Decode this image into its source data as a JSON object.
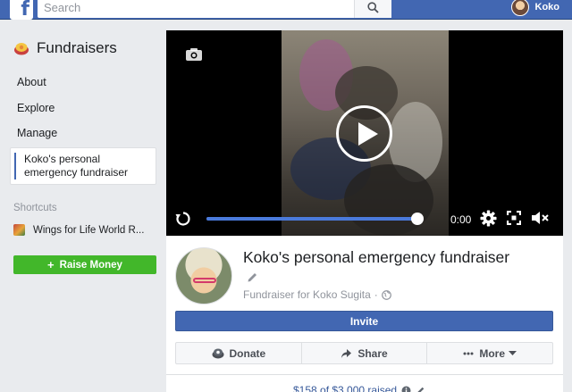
{
  "topbar": {
    "logo_letter": "f",
    "search_placeholder": "Search",
    "user_name": "Koko"
  },
  "sidebar": {
    "title": "Fundraisers",
    "links": [
      "About",
      "Explore",
      "Manage"
    ],
    "active_item": "Koko's personal emergency fundraiser",
    "shortcuts_label": "Shortcuts",
    "shortcut_item": "Wings for Life World R...",
    "raise_button": "Raise Money"
  },
  "video": {
    "time": "0:00",
    "progress": 0.98
  },
  "fundraiser": {
    "title": "Koko's personal emergency fundraiser",
    "subtitle": "Fundraiser for Koko Sugita",
    "invite_label": "Invite",
    "actions": [
      "Donate",
      "Share",
      "More"
    ],
    "raised_text": "$158 of $3,000 raised"
  },
  "colors": {
    "brand": "#4267b2",
    "raise_green": "#42b72a",
    "link": "#365899"
  }
}
